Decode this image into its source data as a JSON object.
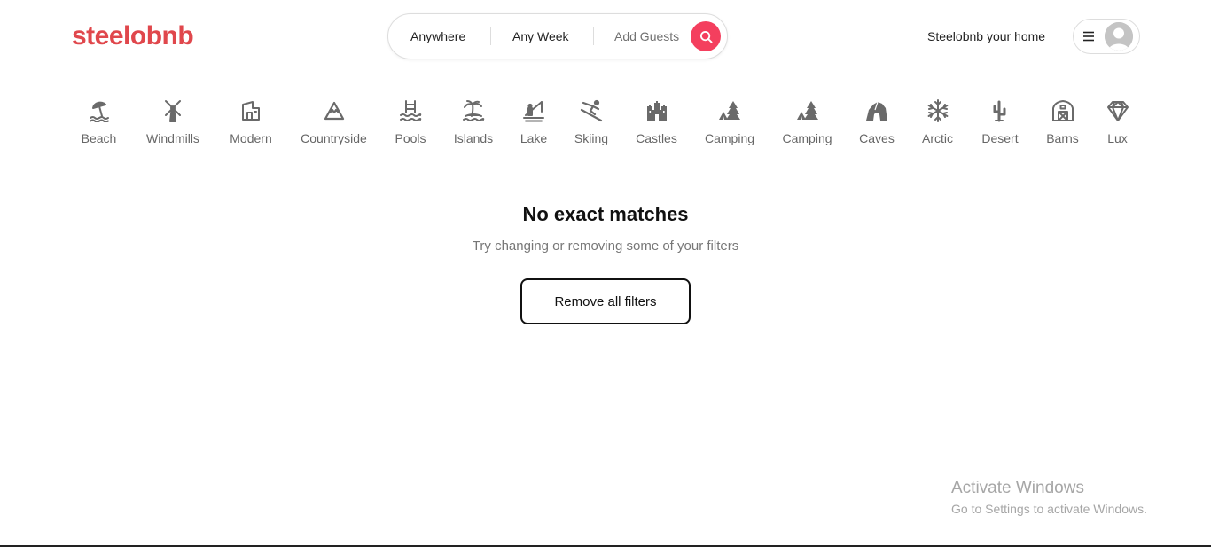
{
  "brand": {
    "logo": "steelobnb",
    "color": "#e0474c"
  },
  "search": {
    "location": "Anywhere",
    "week": "Any Week",
    "guests": "Add Guests",
    "button_color": "#f43f5e",
    "icon": "search-icon"
  },
  "header": {
    "host_link": "Steelobnb your home",
    "menu_icon": "hamburger-menu-icon",
    "avatar_icon": "user-avatar-icon"
  },
  "categories": [
    {
      "label": "Beach",
      "icon": "beach-umbrella-icon"
    },
    {
      "label": "Windmills",
      "icon": "windmill-icon"
    },
    {
      "label": "Modern",
      "icon": "modern-house-icon"
    },
    {
      "label": "Countryside",
      "icon": "mountain-icon"
    },
    {
      "label": "Pools",
      "icon": "pool-icon"
    },
    {
      "label": "Islands",
      "icon": "island-icon"
    },
    {
      "label": "Lake",
      "icon": "lake-fishing-icon"
    },
    {
      "label": "Skiing",
      "icon": "skier-icon"
    },
    {
      "label": "Castles",
      "icon": "castle-icon"
    },
    {
      "label": "Camping",
      "icon": "camping-tent-icon"
    },
    {
      "label": "Camping",
      "icon": "camping-tent-icon"
    },
    {
      "label": "Caves",
      "icon": "cave-icon"
    },
    {
      "label": "Arctic",
      "icon": "snowflake-icon"
    },
    {
      "label": "Desert",
      "icon": "cactus-icon"
    },
    {
      "label": "Barns",
      "icon": "barn-icon"
    },
    {
      "label": "Lux",
      "icon": "diamond-icon"
    }
  ],
  "empty_state": {
    "title": "No exact matches",
    "subtitle": "Try changing or removing some of your filters",
    "button": "Remove all filters"
  },
  "watermark": {
    "title": "Activate Windows",
    "subtitle": "Go to Settings to activate Windows."
  }
}
